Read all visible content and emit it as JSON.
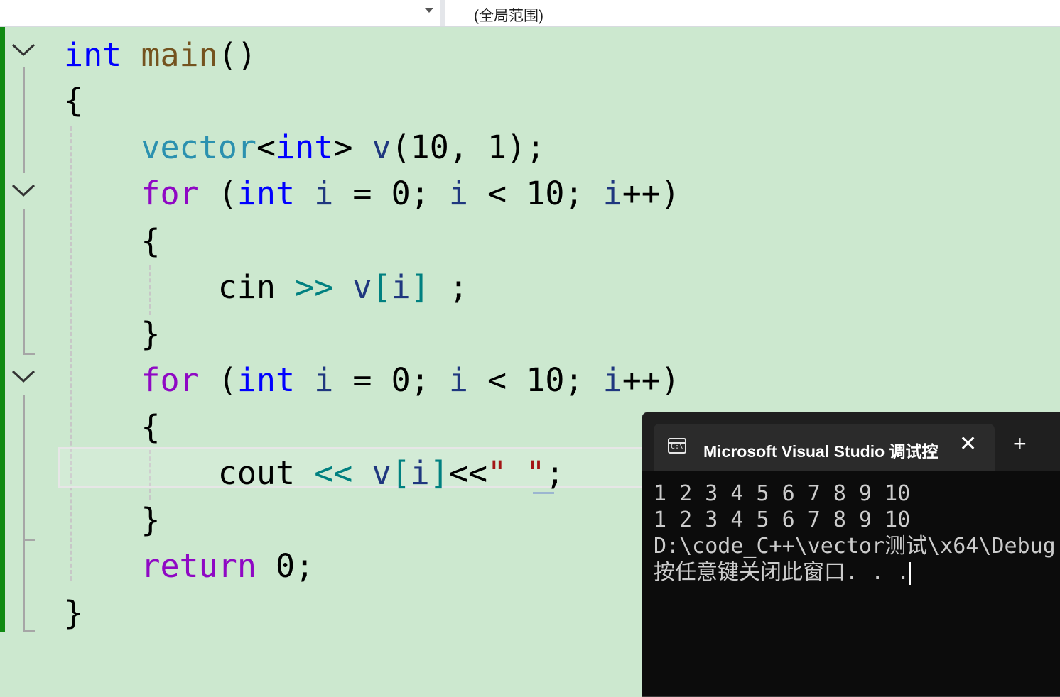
{
  "navbar": {
    "scope_label": "(全局范围)"
  },
  "editor": {
    "lines": [
      [
        {
          "t": "int",
          "c": "kw"
        },
        {
          "t": " ",
          "c": ""
        },
        {
          "t": "main",
          "c": "fn"
        },
        {
          "t": "()",
          "c": ""
        }
      ],
      [
        {
          "t": "{",
          "c": ""
        }
      ],
      [
        {
          "t": "    ",
          "c": ""
        },
        {
          "t": "vector",
          "c": "ty"
        },
        {
          "t": "<",
          "c": ""
        },
        {
          "t": "int",
          "c": "kw"
        },
        {
          "t": "> ",
          "c": ""
        },
        {
          "t": "v",
          "c": "var"
        },
        {
          "t": "(10, 1);",
          "c": ""
        }
      ],
      [
        {
          "t": "    ",
          "c": ""
        },
        {
          "t": "for",
          "c": "kw2"
        },
        {
          "t": " (",
          "c": ""
        },
        {
          "t": "int",
          "c": "kw"
        },
        {
          "t": " ",
          "c": ""
        },
        {
          "t": "i",
          "c": "var"
        },
        {
          "t": " = 0; ",
          "c": ""
        },
        {
          "t": "i",
          "c": "var"
        },
        {
          "t": " < 10; ",
          "c": ""
        },
        {
          "t": "i",
          "c": "var"
        },
        {
          "t": "++)",
          "c": ""
        }
      ],
      [
        {
          "t": "    {",
          "c": ""
        }
      ],
      [
        {
          "t": "        cin ",
          "c": ""
        },
        {
          "t": ">>",
          "c": "op"
        },
        {
          "t": " ",
          "c": ""
        },
        {
          "t": "v",
          "c": "var"
        },
        {
          "t": "[",
          "c": "op"
        },
        {
          "t": "i",
          "c": "var"
        },
        {
          "t": "]",
          "c": "op"
        },
        {
          "t": " ;",
          "c": ""
        }
      ],
      [
        {
          "t": "    }",
          "c": ""
        }
      ],
      [
        {
          "t": "    ",
          "c": ""
        },
        {
          "t": "for",
          "c": "kw2"
        },
        {
          "t": " (",
          "c": ""
        },
        {
          "t": "int",
          "c": "kw"
        },
        {
          "t": " ",
          "c": ""
        },
        {
          "t": "i",
          "c": "var"
        },
        {
          "t": " = 0; ",
          "c": ""
        },
        {
          "t": "i",
          "c": "var"
        },
        {
          "t": " < 10; ",
          "c": ""
        },
        {
          "t": "i",
          "c": "var"
        },
        {
          "t": "++)",
          "c": ""
        }
      ],
      [
        {
          "t": "    {",
          "c": ""
        }
      ],
      [
        {
          "t": "        cout ",
          "c": ""
        },
        {
          "t": "<<",
          "c": "op"
        },
        {
          "t": " ",
          "c": ""
        },
        {
          "t": "v",
          "c": "var"
        },
        {
          "t": "[",
          "c": "op"
        },
        {
          "t": "i",
          "c": "var"
        },
        {
          "t": "]",
          "c": "op"
        },
        {
          "t": "<<",
          "c": ""
        },
        {
          "t": "\" \"",
          "c": "str"
        },
        {
          "t": ";",
          "c": ""
        }
      ],
      [
        {
          "t": "    }",
          "c": ""
        }
      ],
      [
        {
          "t": "    ",
          "c": ""
        },
        {
          "t": "return",
          "c": "kw2"
        },
        {
          "t": " 0;",
          "c": ""
        }
      ],
      [
        {
          "t": "}",
          "c": ""
        }
      ]
    ]
  },
  "console": {
    "tab_title": "Microsoft Visual Studio 调试控制台",
    "icon_text": "C:\\",
    "close_label": "✕",
    "new_tab_label": "+",
    "output": [
      "1 2 3 4 5 6 7 8 9 10",
      "1 2 3 4 5 6 7 8 9 10",
      "D:\\code_C++\\vector测试\\x64\\Debug",
      "按任意键关闭此窗口. . ."
    ]
  }
}
